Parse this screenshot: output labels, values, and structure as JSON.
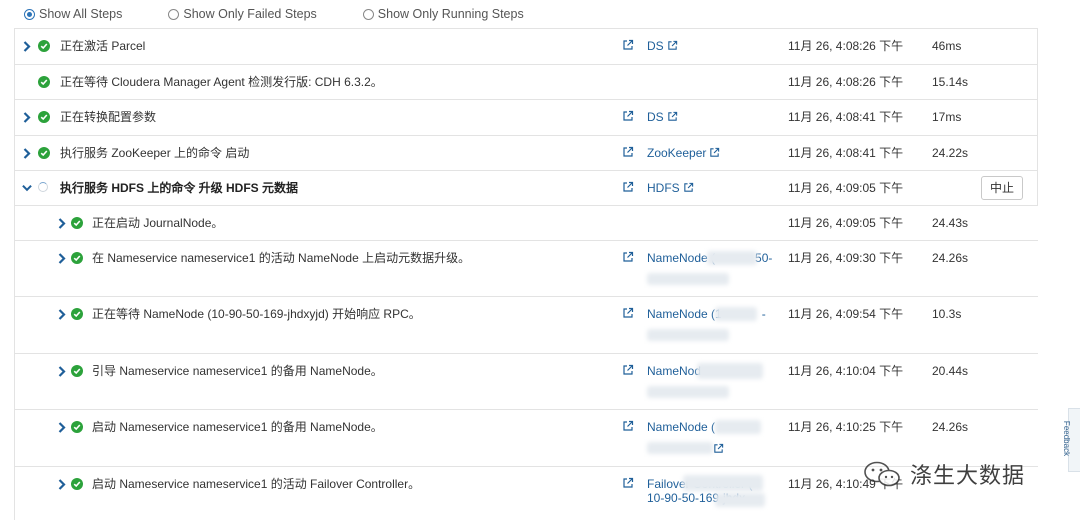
{
  "filters": [
    {
      "label": "Show All Steps",
      "checked": true
    },
    {
      "label": "Show Only Failed Steps",
      "checked": false
    },
    {
      "label": "Show Only Running Steps",
      "checked": false
    }
  ],
  "steps": [
    {
      "desc": "正在激活 Parcel",
      "role": "DS",
      "time": "11月 26, 4:08:26 下午",
      "duration": "46ms"
    },
    {
      "desc": "正在等待 Cloudera Manager Agent 检测发行版: CDH 6.3.2。",
      "role": "",
      "time": "11月 26, 4:08:26 下午",
      "duration": "15.14s"
    },
    {
      "desc": "正在转换配置参数",
      "role": "DS",
      "time": "11月 26, 4:08:41 下午",
      "duration": "17ms"
    },
    {
      "desc": "执行服务 ZooKeeper 上的命令 启动",
      "role": "ZooKeeper",
      "time": "11月 26, 4:08:41 下午",
      "duration": "24.22s"
    },
    {
      "desc": "执行服务 HDFS 上的命令 升级 HDFS 元数据",
      "role": "HDFS",
      "time": "11月 26, 4:09:05 下午",
      "duration": "",
      "action": "中止"
    },
    {
      "desc": "正在启动 JournalNode。",
      "role": "",
      "time": "11月 26, 4:09:05 下午",
      "duration": "24.43s"
    },
    {
      "desc": "在 Nameservice nameservice1 的活动 NameNode 上启动元数据升级。",
      "role": "NameNode (",
      "role_tail": "50-",
      "time": "11月 26, 4:09:30 下午",
      "duration": "24.26s"
    },
    {
      "desc": "正在等待 NameNode (10-90-50-169-jhdxyjd) 开始响应 RPC。",
      "role": "NameNode (1",
      "role_tail": "-",
      "time": "11月 26, 4:09:54 下午",
      "duration": "10.3s"
    },
    {
      "desc": "引导 Nameservice nameservice1 的备用 NameNode。",
      "role": "NameNod",
      "time": "11月 26, 4:10:04 下午",
      "duration": "20.44s"
    },
    {
      "desc": "启动 Nameservice nameservice1 的备用 NameNode。",
      "role": "NameNode (",
      "time": "11月 26, 4:10:25 下午",
      "duration": "24.26s"
    },
    {
      "desc": "启动 Nameservice nameservice1 的活动 Failover Controller。",
      "role": "Failover Controller (",
      "role_line2": "10-90-50-169-jhdx",
      "time": "11月 26, 4:10:49 下午",
      "duration": ""
    }
  ],
  "feedback_label": "Feedback",
  "watermark": "涤生大数据",
  "colors": {
    "link": "#1f5f99",
    "success": "#2ca23b",
    "radio": "#2b73b7"
  }
}
